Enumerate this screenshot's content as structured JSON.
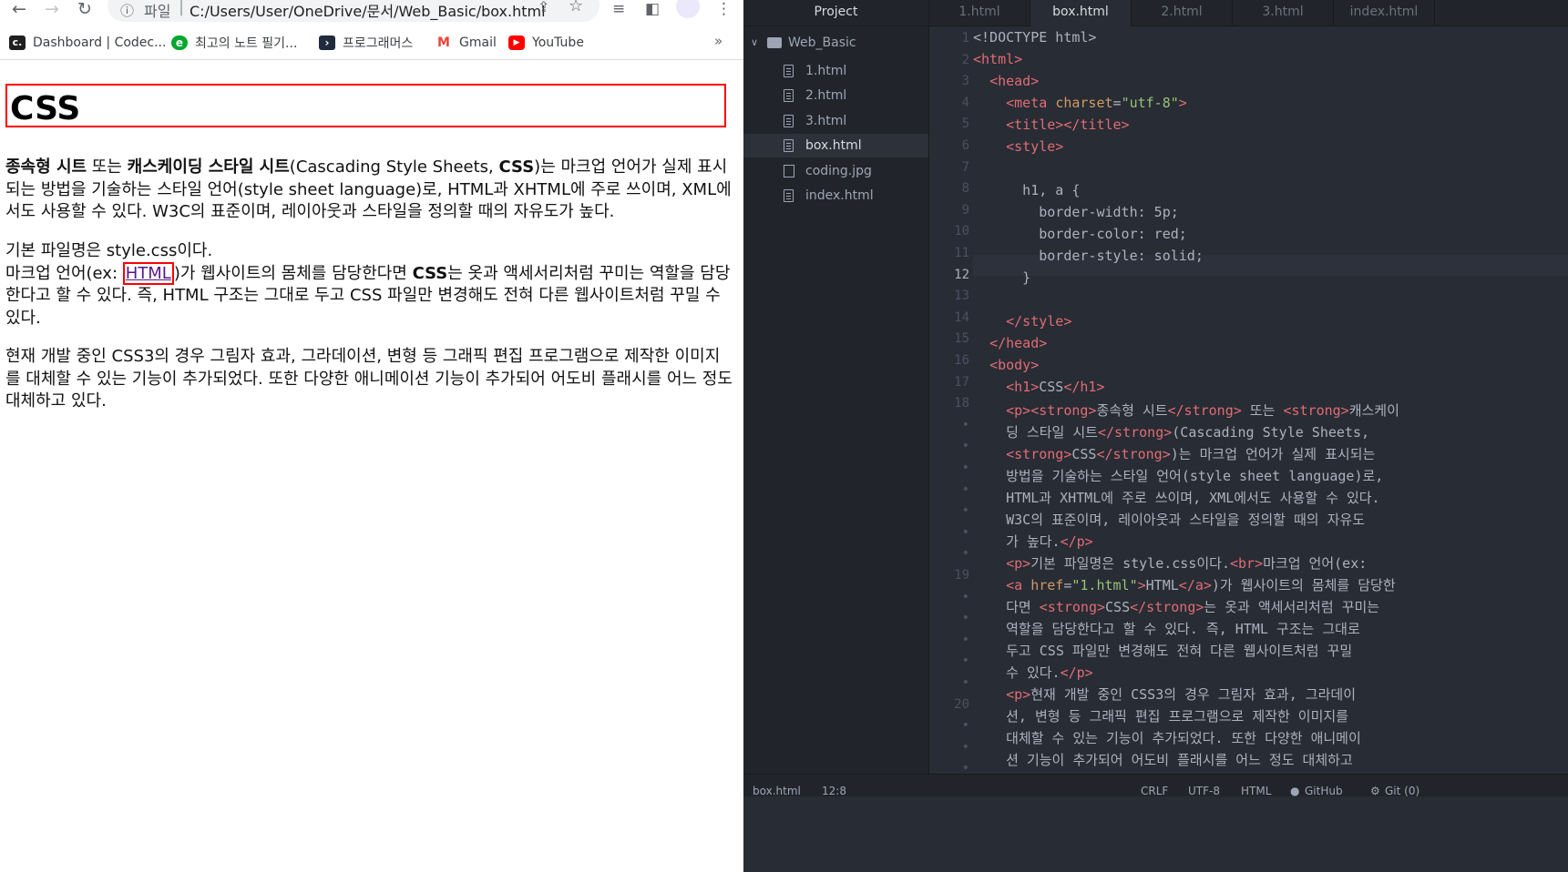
{
  "browser": {
    "toolbar": {
      "back_icon": "←",
      "forward_icon": "→",
      "reload_icon": "↻",
      "scheme_label": "파일",
      "separator": "|",
      "url": "C:/Users/User/OneDrive/문서/Web_Basic/box.html"
    },
    "bookmarks": [
      {
        "label": "Dashboard | Codec...",
        "icon": "codecademy-icon",
        "color": "#1f1f1f"
      },
      {
        "label": "최고의 노트 필기...",
        "icon": "evernote-icon",
        "color": "#00a82d"
      },
      {
        "label": "프로그래머스",
        "icon": "programmers-icon",
        "color": "#202b3d"
      },
      {
        "label": "Gmail",
        "icon": "gmail-icon",
        "color": "#ea4335"
      },
      {
        "label": "YouTube",
        "icon": "youtube-icon",
        "color": "#ff0000"
      }
    ],
    "bookmarks_more": "»",
    "page": {
      "heading": "CSS",
      "p1": {
        "s1": "종속형 시트",
        "t1": " 또는 ",
        "s2": "캐스케이딩 스타일 시트",
        "t2": "(Cascading Style Sheets, ",
        "s3": "CSS",
        "t3": ")는 마크업 언어가 실제 표시되는 방법을 기술하는 스타일 언어(style sheet language)로, HTML과 XHTML에 주로 쓰이며, XML에서도 사용할 수 있다. W3C의 표준이며, 레이아웃과 스타일을 정의할 때의 자유도가 높다."
      },
      "p2": {
        "line1": "기본 파일명은 style.css이다.",
        "t1": "마크업 언어(ex: ",
        "link": "HTML",
        "t2": ")가 웹사이트의 몸체를 담당한다면 ",
        "s1": "CSS",
        "t3": "는 옷과 액세서리처럼 꾸미는 역할을 담당한다고 할 수 있다. 즉, HTML 구조는 그대로 두고 CSS 파일만 변경해도 전혀 다른 웹사이트처럼 꾸밀 수 있다."
      },
      "p3": "현재 개발 중인 CSS3의 경우 그림자 효과, 그라데이션, 변형 등 그래픽 편집 프로그램으로 제작한 이미지를 대체할 수 있는 기능이 추가되었다. 또한 다양한 애니메이션 기능이 추가되어 어도비 플래시를 어느 정도 대체하고 있다."
    }
  },
  "editor": {
    "project_title": "Project",
    "folder": "Web_Basic",
    "files": [
      "1.html",
      "2.html",
      "3.html",
      "box.html",
      "coding.jpg",
      "index.html"
    ],
    "selected_file": "box.html",
    "tabs": [
      "1.html",
      "box.html",
      "2.html",
      "3.html",
      "index.html"
    ],
    "active_tab": "box.html",
    "line_numbers": [
      "1",
      "2",
      "3",
      "4",
      "5",
      "6",
      "7",
      "8",
      "9",
      "10",
      "11",
      "12",
      "13",
      "14",
      "15",
      "16",
      "17",
      "18",
      "•",
      "•",
      "•",
      "•",
      "•",
      "•",
      "•",
      "19",
      "•",
      "•",
      "•",
      "•",
      "•",
      "20",
      "•",
      "•",
      "•",
      "•"
    ],
    "current_line": "12",
    "status": {
      "file": "box.html",
      "cursor": "12:8",
      "line_ending": "CRLF",
      "encoding": "UTF-8",
      "grammar": "HTML",
      "github": "GitHub",
      "git": "Git (0)"
    },
    "colors": {
      "background": "#282c34",
      "tag": "#e06c75",
      "attribute": "#d19a66",
      "string": "#98c379",
      "text": "#abb2bf"
    }
  }
}
